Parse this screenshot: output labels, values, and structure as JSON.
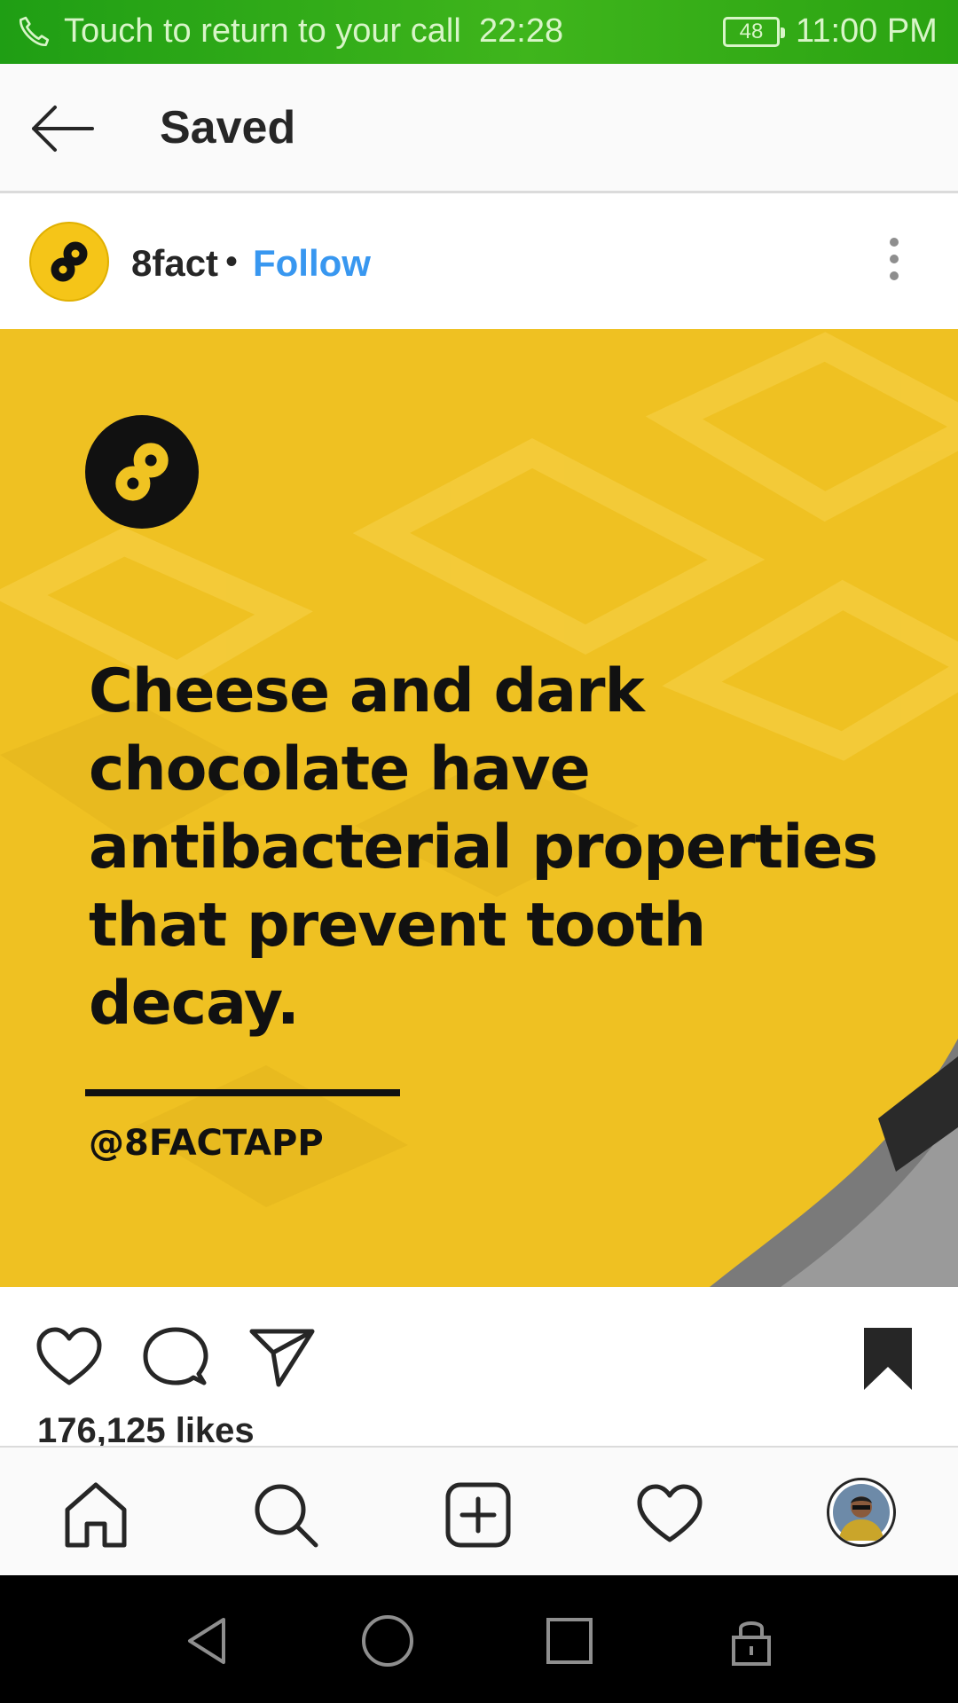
{
  "status_bar": {
    "call_text": "Touch to return to your call",
    "call_timer": "22:28",
    "battery": "48",
    "time": "11:00 PM"
  },
  "header": {
    "title": "Saved"
  },
  "post": {
    "username": "8fact",
    "separator": "•",
    "follow_label": "Follow",
    "fact_text": "Cheese and dark chocolate have antibacterial properties that prevent tooth decay.",
    "handle": "@8FACTAPP",
    "likes": "176,125 likes",
    "brand_color": "#f0c322"
  },
  "icons": {
    "back": "arrow-left-icon",
    "more": "more-vertical-icon",
    "like": "heart-icon",
    "comment": "comment-icon",
    "share": "send-icon",
    "save": "bookmark-filled-icon",
    "nav_home": "home-icon",
    "nav_search": "search-icon",
    "nav_add": "add-post-icon",
    "nav_activity": "heart-icon",
    "nav_profile": "profile-avatar"
  },
  "colors": {
    "status_bar": "#2aa312",
    "link": "#3897f0",
    "text": "#262626"
  }
}
